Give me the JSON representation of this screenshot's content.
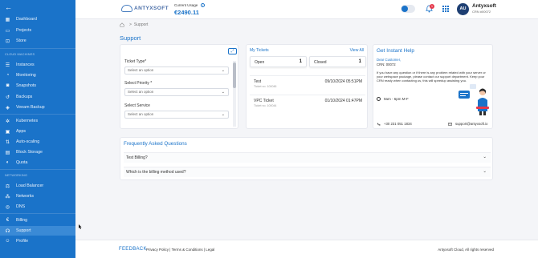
{
  "sidebar": {
    "back_label": "←",
    "sections": {
      "cloud_machines": "CLOUD MACHINES",
      "networking": "NETWORKING"
    },
    "items": [
      {
        "label": "Dashboard",
        "icon": "grid-icon"
      },
      {
        "label": "Projects",
        "icon": "folder-icon"
      },
      {
        "label": "Store",
        "icon": "cart-icon"
      },
      {
        "label": "Instances",
        "icon": "server-icon"
      },
      {
        "label": "Monitoring",
        "icon": "chart-icon"
      },
      {
        "label": "Snapshots",
        "icon": "camera-icon"
      },
      {
        "label": "Backups",
        "icon": "backup-icon"
      },
      {
        "label": "Veeam Backup",
        "icon": "shield-icon"
      },
      {
        "label": "Kubernetes",
        "icon": "kubernetes-icon"
      },
      {
        "label": "Apps",
        "icon": "apps-icon"
      },
      {
        "label": "Auto-scaling",
        "icon": "scale-icon"
      },
      {
        "label": "Block Storage",
        "icon": "storage-icon"
      },
      {
        "label": "Quota",
        "icon": "quota-icon"
      },
      {
        "label": "Load Balancer",
        "icon": "balancer-icon"
      },
      {
        "label": "Networks",
        "icon": "network-icon"
      },
      {
        "label": "DNS",
        "icon": "dns-icon"
      },
      {
        "label": "Billing",
        "icon": "euro-icon"
      },
      {
        "label": "Support",
        "icon": "headset-icon"
      },
      {
        "label": "Profile",
        "icon": "user-icon"
      }
    ],
    "active": "Support"
  },
  "header": {
    "logo_text": "ANTYXSOFT",
    "usage_label": "Current Usage",
    "usage_value": "€2490.11",
    "notification_count": "1",
    "avatar_initials": "AU",
    "user_name": "Antyxsoft",
    "user_crn": "CRN #00072"
  },
  "breadcrumb": {
    "current": "Support",
    "separator": ">"
  },
  "page_title": "Support",
  "form": {
    "fields": [
      {
        "label": "Ticket Type*",
        "value": "Select an option"
      },
      {
        "label": "Select Priority *",
        "value": "Select an option"
      },
      {
        "label": "Select Service",
        "value": "Select an option"
      }
    ]
  },
  "tickets": {
    "title": "My Tickets",
    "view_all": "View All",
    "open_label": "Open",
    "open_count": "1",
    "closed_label": "Closed",
    "closed_count": "1",
    "rows": [
      {
        "name": "Test",
        "number": "Ticket no. 100045",
        "date": "09/10/2024 05:51PM"
      },
      {
        "name": "VPC Ticket",
        "number": "Ticket no. 100044",
        "date": "01/10/2024 01:47PM"
      }
    ]
  },
  "help": {
    "title": "Get Instant Help",
    "greeting": "Dear Customer,",
    "crn": "CRN: 00072",
    "body": "If you have any question or if there is any problem related with your server or your webspace package, please contact our support department. Keep your CRN ready when contacting us, this will speedup assisting you.",
    "hours": "9am - 6pm M-F",
    "phone": "+30 231 051 1834",
    "email": "support@antyxsoft.io"
  },
  "faq": {
    "title": "Frequently Asked Questions",
    "items": [
      "Test Billing?",
      "Which is the billing method used?"
    ]
  },
  "footer": {
    "brand": "FEEDBACK",
    "links": "Privacy Policy  |  Terms & Conditions  |  Legal",
    "copyright": "Antyxsoft Cloud, All rights reserved"
  },
  "colors": {
    "primary": "#1a73c9",
    "sidebar": "#1a73c9",
    "active": "#3a8ad6"
  }
}
